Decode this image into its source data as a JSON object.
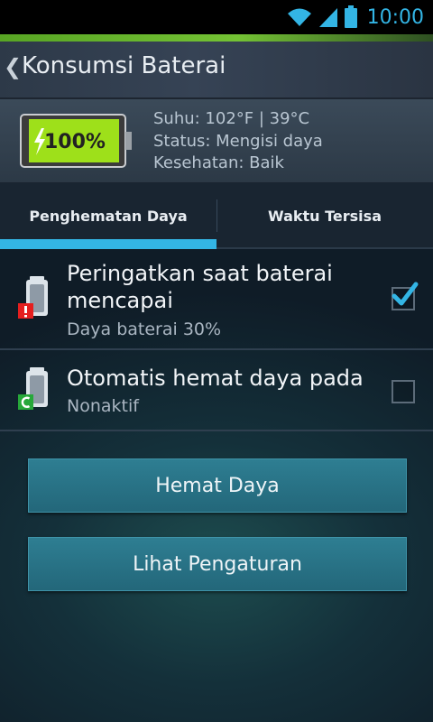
{
  "status_bar": {
    "time": "10:00",
    "icons": [
      "wifi-icon",
      "signal-icon",
      "battery-icon"
    ],
    "accent_color": "#33b5e5"
  },
  "header": {
    "back_icon": "chevron-left-icon",
    "title": "Konsumsi Baterai"
  },
  "battery_info": {
    "level": 1.0,
    "percent_label": "100%",
    "charging_icon": "lightning-icon",
    "fill_color": "#9ee01a",
    "temperature": "Suhu: 102°F | 39°C",
    "status": "Status: Mengisi daya",
    "health": "Kesehatan: Baik"
  },
  "tabs": [
    {
      "label": "Penghematan Daya",
      "selected": true
    },
    {
      "label": "Waktu Tersisa",
      "selected": false
    }
  ],
  "settings": [
    {
      "icon": "battery-warning-icon",
      "badge_color": "#e51e1e",
      "title_lines": [
        "Peringatkan saat baterai",
        "mencapai"
      ],
      "subtitle": "Daya baterai 30%",
      "checked": true
    },
    {
      "icon": "battery-cycle-icon",
      "badge_color": "#27a83a",
      "title_lines": [
        "Otomatis hemat daya pada"
      ],
      "subtitle": "Nonaktif",
      "checked": false
    }
  ],
  "buttons": {
    "save_power": "Hemat Daya",
    "view_settings": "Lihat Pengaturan"
  }
}
